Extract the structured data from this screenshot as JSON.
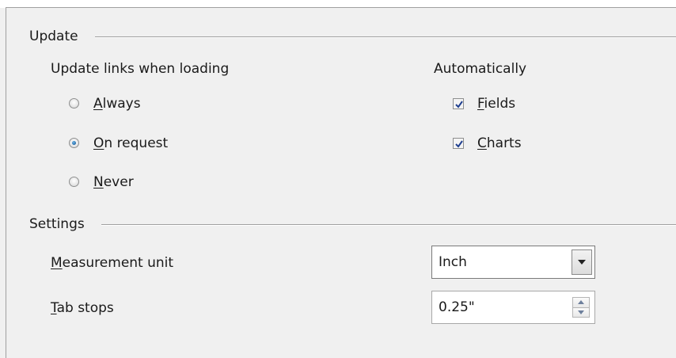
{
  "update": {
    "title": "Update",
    "links_label": "Update links when loading",
    "options": [
      {
        "label": "Always",
        "accel": "A",
        "rest": "lways",
        "checked": false
      },
      {
        "label": "On request",
        "accel": "O",
        "rest": "n request",
        "checked": true
      },
      {
        "label": "Never",
        "accel": "N",
        "rest": "ever",
        "checked": false
      }
    ],
    "auto_label": "Automatically",
    "auto_items": [
      {
        "label": "Fields",
        "accel": "F",
        "rest": "ields",
        "checked": true
      },
      {
        "label": "Charts",
        "accel": "C",
        "rest": "harts",
        "checked": true
      }
    ]
  },
  "settings": {
    "title": "Settings",
    "measurement": {
      "label": "Measurement unit",
      "accel": "M",
      "rest": "easurement unit",
      "value": "Inch"
    },
    "tabstops": {
      "label": "Tab stops",
      "accel": "T",
      "rest": "ab stops",
      "value": "0.25\""
    }
  },
  "colors": {
    "panel": "#f0f0f0",
    "radio_dot": "#1a5f9e",
    "check_mark": "#1f3f8f"
  },
  "icons": {
    "combo": "chevron-down-icon",
    "spin_up": "arrow-up-icon",
    "spin_down": "arrow-down-icon"
  }
}
